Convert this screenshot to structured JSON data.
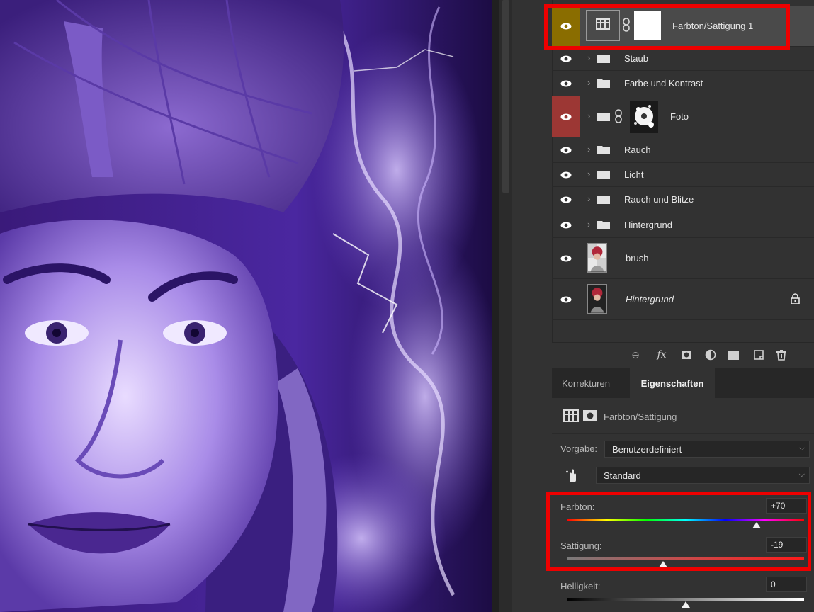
{
  "layers": [
    {
      "name": "Farbton/Sättigung 1",
      "type": "adjustment",
      "selected": true,
      "visibility_color": "#8a6d00"
    },
    {
      "name": "Staub",
      "type": "group"
    },
    {
      "name": "Farbe und Kontrast",
      "type": "group"
    },
    {
      "name": "Foto",
      "type": "group-mask",
      "visibility_color": "#9c3734"
    },
    {
      "name": "Rauch",
      "type": "group"
    },
    {
      "name": "Licht",
      "type": "group"
    },
    {
      "name": "Rauch und Blitze",
      "type": "group"
    },
    {
      "name": "Hintergrund",
      "type": "group"
    },
    {
      "name": "brush",
      "type": "image"
    },
    {
      "name": "Hintergrund",
      "type": "image-locked"
    }
  ],
  "footer_icons": [
    "link-icon",
    "fx-icon",
    "mask-icon",
    "adjustment-icon",
    "folder-icon",
    "new-layer-icon",
    "trash-icon"
  ],
  "tabs": {
    "korrekturen": "Korrekturen",
    "eigenschaften": "Eigenschaften"
  },
  "properties": {
    "title": "Farbton/Sättigung",
    "vorgabe_label": "Vorgabe:",
    "vorgabe_value": "Benutzerdefiniert",
    "channel_value": "Standard",
    "hue": {
      "label": "Farbton:",
      "value": "+70",
      "fraction": 0.8
    },
    "saturation": {
      "label": "Sättigung:",
      "value": "-19",
      "fraction": 0.405
    },
    "lightness": {
      "label": "Helligkeit:",
      "value": "0",
      "fraction": 0.5
    }
  },
  "colors": {
    "panel": "#323232",
    "highlight": "#ee0000",
    "selected_row": "#4a4a4a"
  }
}
